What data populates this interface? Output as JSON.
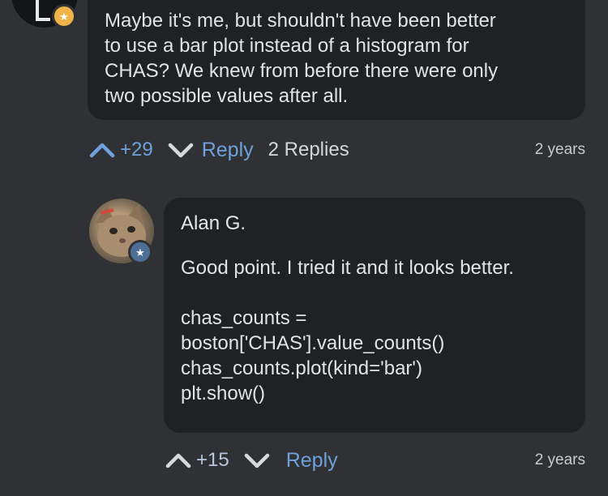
{
  "comments": [
    {
      "body": "Maybe it's me, but shouldn't have been better\nto use a bar plot instead of a histogram for\nCHAS? We knew from before there were only\ntwo possible values after all.",
      "votes": "+29",
      "reply_label": "Reply",
      "replies_label": "2 Replies",
      "time": "2 years",
      "badge_icon": "★",
      "accent": "#6fa1dc"
    },
    {
      "author": "Alan G.",
      "body": "Good point. I tried it and it looks better.\n\nchas_counts =\nboston['CHAS'].value_counts()\nchas_counts.plot(kind='bar')\nplt.show()",
      "votes": "+15",
      "reply_label": "Reply",
      "time": "2 years",
      "badge_icon": "★"
    }
  ]
}
